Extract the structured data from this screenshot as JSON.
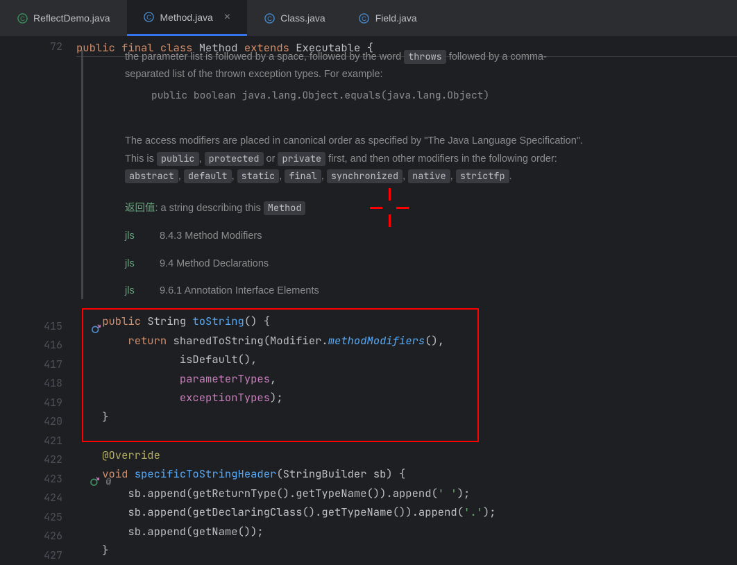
{
  "tabs": [
    {
      "label": "ReflectDemo.java",
      "icon": "class"
    },
    {
      "label": "Method.java",
      "icon": "class",
      "active": true
    },
    {
      "label": "Class.java",
      "icon": "class"
    },
    {
      "label": "Field.java",
      "icon": "class"
    }
  ],
  "sticky_line_number": "72",
  "sticky": {
    "kw1": "public ",
    "kw2": "final ",
    "kw3": "class ",
    "cls": "Method ",
    "kw4": "extends ",
    "sup": "Executable ",
    "brace": "{"
  },
  "doc": {
    "p1a": "the parameter list is followed by a space, followed by the word ",
    "p1_throws": "throws",
    "p1b": " followed by a comma-",
    "p1c": "separated list of the thrown exception types. For example:",
    "example": "public boolean java.lang.Object.equals(java.lang.Object)",
    "p2a": "The access modifiers are placed in canonical order as specified by \"The Java Language Specification\".",
    "p2b_a": "This is ",
    "p2b_public": "public",
    "p2b_c1": ", ",
    "p2b_protected": "protected",
    "p2b_or": " or ",
    "p2b_private": "private",
    "p2b_b": " first, and then other modifiers in the following order:",
    "p2c_abstract": "abstract",
    "p2c_c1": ", ",
    "p2c_default": "default",
    "p2c_c2": ", ",
    "p2c_static": "static",
    "p2c_c3": ", ",
    "p2c_final": "final",
    "p2c_c4": ", ",
    "p2c_synchronized": "synchronized",
    "p2c_c5": ", ",
    "p2c_native": "native",
    "p2c_c6": ", ",
    "p2c_strictfp": "strictfp",
    "p2c_dot": ".",
    "ret_label": "返回值:",
    "ret_text": " a string describing this ",
    "ret_tag": "Method",
    "jls1_label": "jls",
    "jls1_text": "8.4.3 Method Modifiers",
    "jls2_label": "jls",
    "jls2_text": "9.4 Method Declarations",
    "jls3_label": "jls",
    "jls3_text": "9.6.1 Annotation Interface Elements"
  },
  "lines": {
    "l415_num": "415",
    "l415_kw": "public ",
    "l415_type": "String ",
    "l415_m": "toString",
    "l415_rest": "() {",
    "l416_num": "416",
    "l416_kw": "return ",
    "l416_call": "sharedToString(Modifier.",
    "l416_mi": "methodModifiers",
    "l416_end": "(),",
    "l417_num": "417",
    "l417_call": "isDefault(),",
    "l418_num": "418",
    "l418_f": "parameterTypes",
    "l418_end": ",",
    "l419_num": "419",
    "l419_f": "exceptionTypes",
    "l419_end": ");",
    "l420_num": "420",
    "l420_brace": "}",
    "l421_num": "421",
    "l422_num": "422",
    "l422_anno": "@Override",
    "l423_num": "423",
    "l423_kw": "void ",
    "l423_m": "specificToStringHeader",
    "l423_rest": "(StringBuilder sb) {",
    "l424_num": "424",
    "l424_a": "sb.append(getReturnType().getTypeName()).append(",
    "l424_s": "' '",
    "l424_b": ");",
    "l425_num": "425",
    "l425_a": "sb.append(getDeclaringClass().getTypeName()).append(",
    "l425_s": "'.'",
    "l425_b": ");",
    "l426_num": "426",
    "l426_a": "sb.append(getName());",
    "l427_num": "427",
    "l427_brace": "}"
  }
}
